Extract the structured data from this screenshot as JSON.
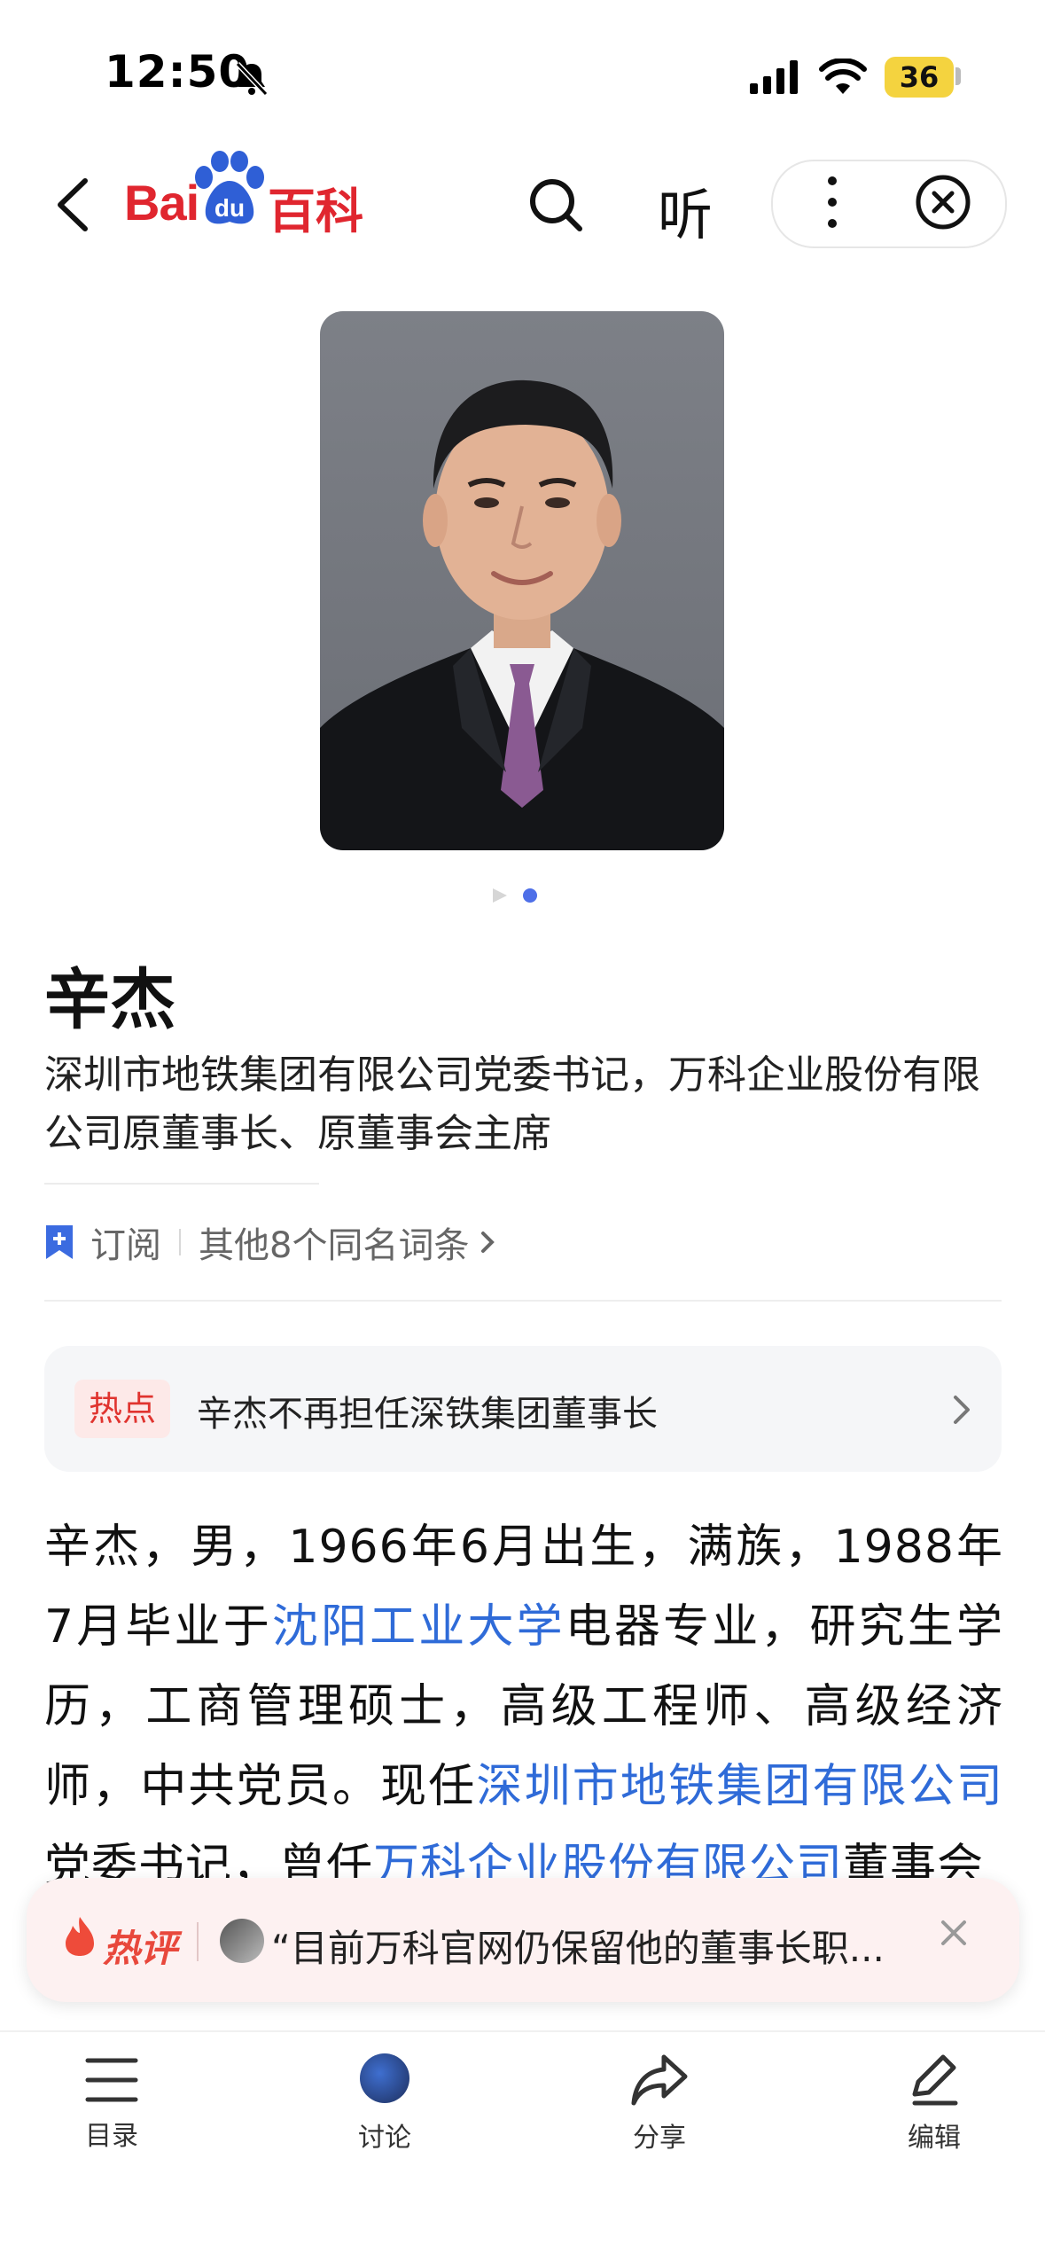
{
  "status_bar": {
    "time": "12:50",
    "battery": "36"
  },
  "nav": {
    "logo_bai": "Bai",
    "logo_du": "du",
    "logo_baike": "百科",
    "listen_label": "听"
  },
  "entry": {
    "title": "辛杰",
    "subtitle": "深圳市地铁集团有限公司党委书记，万科企业股份有限公司原董事长、原董事会主席",
    "subscribe_label": "订阅",
    "homonyms_label": "其他8个同名词条"
  },
  "hot": {
    "tag": "热点",
    "headline": "辛杰不再担任深铁集团董事长"
  },
  "body": {
    "t1": "辛杰，男，1966年6月出生，满族，1988年7月毕业于",
    "link1": "沈阳工业大学",
    "t2": "电器专业，研究生学历，工商管理硕士，高级工程师、高级经济师，中共党员。现任",
    "link2": "深圳市地铁集团有限公司",
    "t3": "党委书记，曾任",
    "link3": "万科企业股份有限公司",
    "t4": "董事会"
  },
  "hot_comment": {
    "label": "热评",
    "text": "“目前万科官网仍保留他的董事长职..."
  },
  "bottom_tabs": [
    {
      "label": "目录"
    },
    {
      "label": "讨论"
    },
    {
      "label": "分享"
    },
    {
      "label": "编辑"
    }
  ],
  "colors": {
    "brand_red": "#e0262f",
    "link_blue": "#2f6bd8",
    "hot_red": "#e0342f"
  }
}
